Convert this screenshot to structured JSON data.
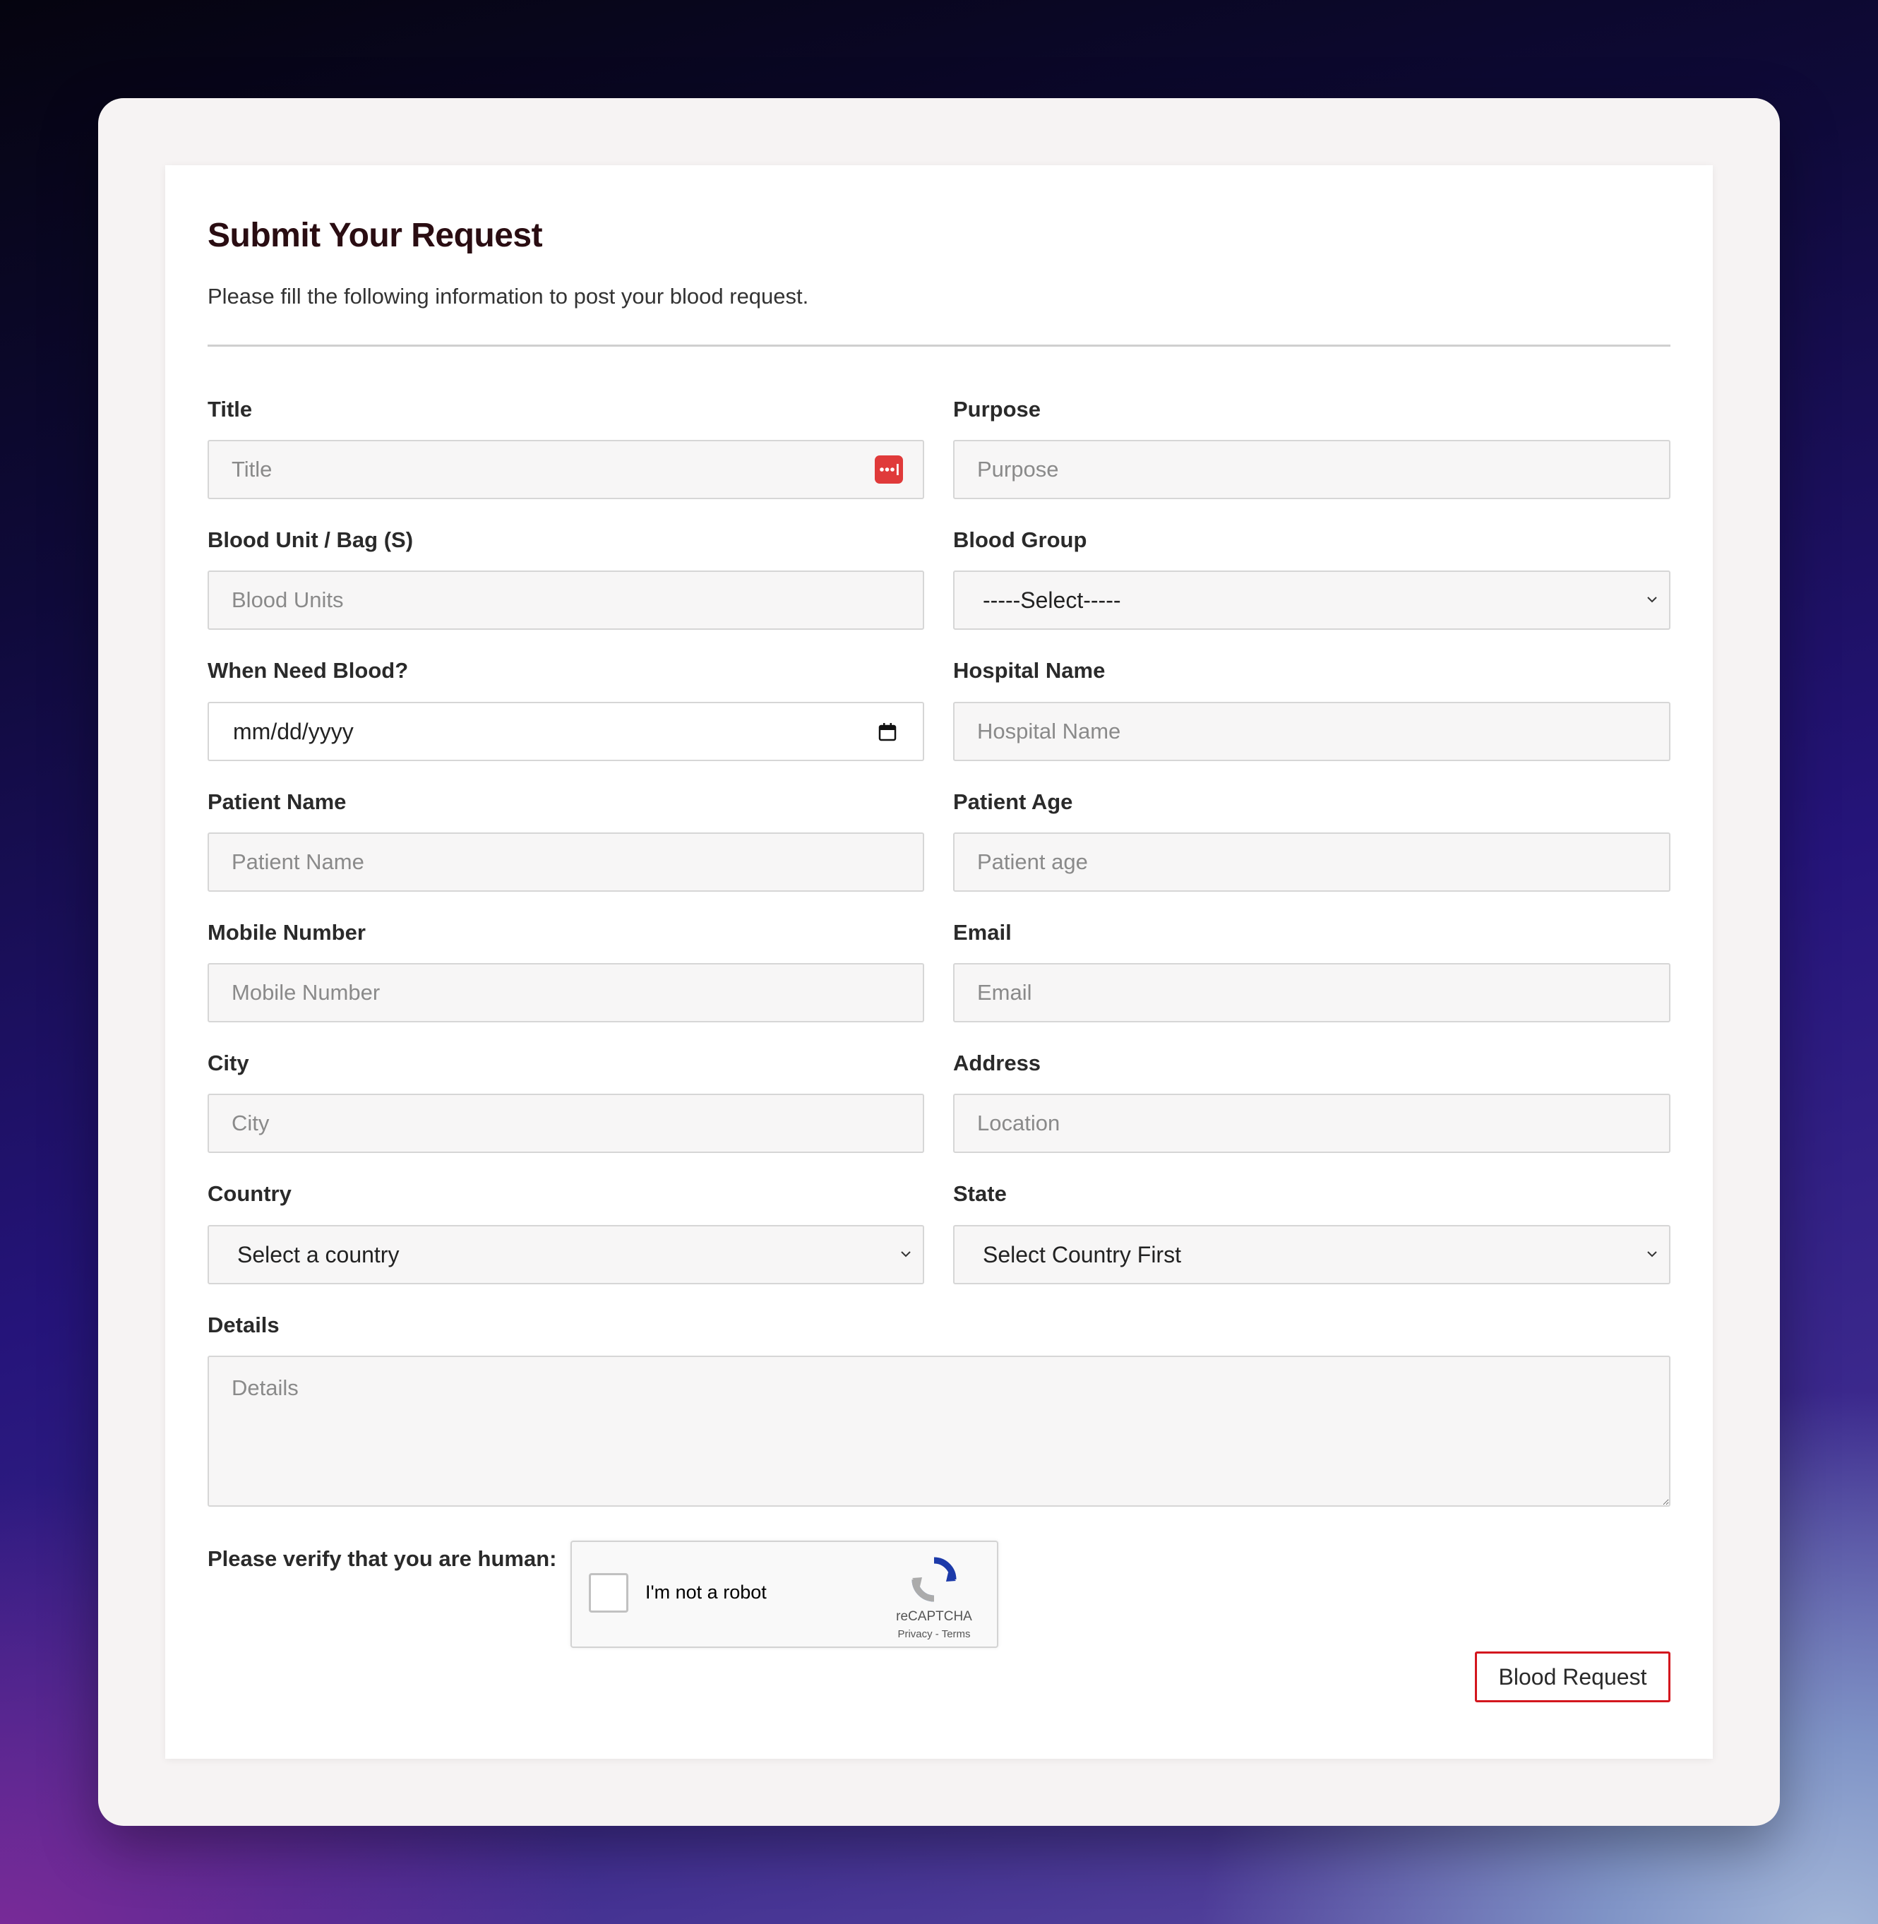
{
  "form": {
    "title": "Submit Your Request",
    "subtitle": "Please fill the following information to post your blood request."
  },
  "fields": {
    "title": {
      "label": "Title",
      "placeholder": "Title"
    },
    "purpose": {
      "label": "Purpose",
      "placeholder": "Purpose"
    },
    "blood_unit": {
      "label": "Blood Unit / Bag (S)",
      "placeholder": "Blood Units"
    },
    "blood_group": {
      "label": "Blood Group",
      "value": "-----Select-----"
    },
    "when_need": {
      "label": "When Need Blood?",
      "value": "mm/dd/yyyy"
    },
    "hospital_name": {
      "label": "Hospital Name",
      "placeholder": "Hospital Name"
    },
    "patient_name": {
      "label": "Patient Name",
      "placeholder": "Patient Name"
    },
    "patient_age": {
      "label": "Patient Age",
      "placeholder": "Patient age"
    },
    "mobile": {
      "label": "Mobile Number",
      "placeholder": "Mobile Number"
    },
    "email": {
      "label": "Email",
      "placeholder": "Email"
    },
    "city": {
      "label": "City",
      "placeholder": "City"
    },
    "address": {
      "label": "Address",
      "placeholder": "Location"
    },
    "country": {
      "label": "Country",
      "value": "Select a country"
    },
    "state": {
      "label": "State",
      "value": "Select Country First"
    },
    "details": {
      "label": "Details",
      "placeholder": "Details"
    }
  },
  "verify": {
    "label": "Please verify that you are human:",
    "checkbox_text": "I'm not a robot",
    "brand": "reCAPTCHA",
    "privacy": "Privacy",
    "separator": " - ",
    "terms": "Terms"
  },
  "submit": {
    "label": "Blood Request"
  },
  "icons": {
    "title_field": "password-manager-icon",
    "date_field": "calendar-icon",
    "select_field": "chevron-down-icon",
    "recaptcha": "recaptcha-logo-icon"
  },
  "colors": {
    "accent": "#d3161e",
    "title_text": "#2a0d12",
    "password_manager_icon": "#e03a3a"
  }
}
